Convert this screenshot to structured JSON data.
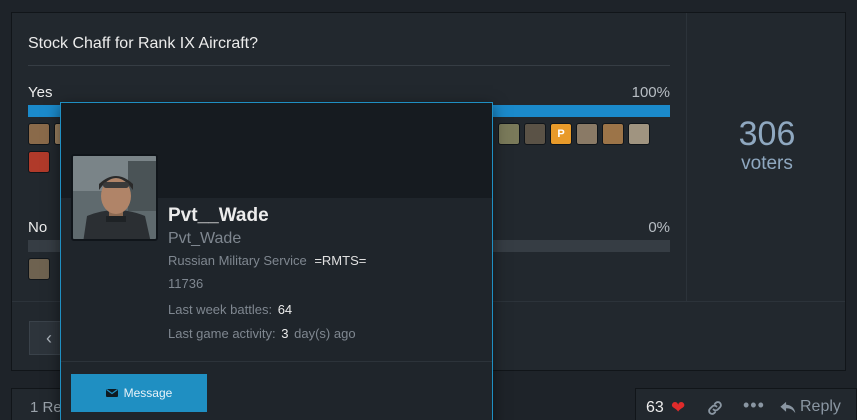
{
  "poll": {
    "title": "Stock Chaff for Rank IX Aircraft?",
    "options": [
      {
        "label": "Yes",
        "percent_text": "100%",
        "fraction": 1.0
      },
      {
        "label": "No",
        "percent_text": "0%",
        "fraction": 0.0
      }
    ],
    "voter_count": "306",
    "voter_word": "voters",
    "avatar_p_letter": "P"
  },
  "footer": {
    "replies_text": "1 Re",
    "reaction_count": "63",
    "heart_icon": "heart-icon",
    "reply_label": "Reply"
  },
  "profile_card": {
    "name": "Pvt__Wade",
    "handle": "Pvt_Wade",
    "clan_name": "Russian Military Service",
    "clan_tag": "=RMTS=",
    "user_id": "11736",
    "stat_battles_label": "Last week battles",
    "stat_battles_value": "64",
    "stat_activity_label": "Last game activity",
    "stat_activity_value": "3",
    "stat_activity_unit": "day(s) ago",
    "message_button": "Message"
  },
  "colors": {
    "accent": "#1f8fc2",
    "bar": "#1b8acb",
    "heart": "#e02b2b",
    "voter_text": "#8fa8c0"
  }
}
